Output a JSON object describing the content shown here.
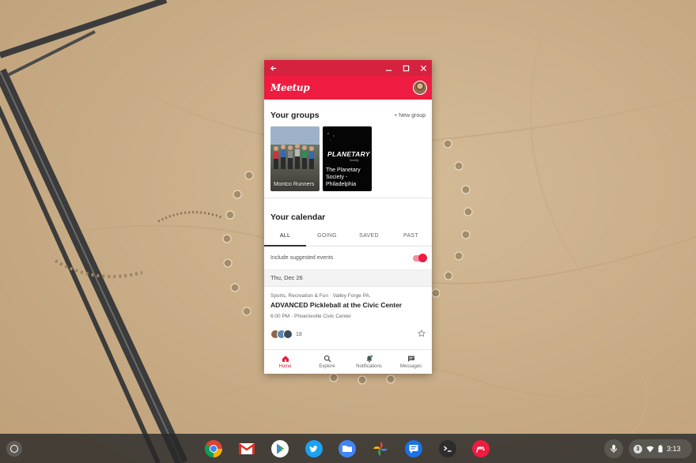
{
  "window": {
    "back_icon": "arrow-left-icon",
    "controls": [
      "minimize-icon",
      "maximize-icon",
      "close-icon"
    ]
  },
  "app": {
    "logo_text": "Meetup",
    "accent_color": "#ed1c40",
    "titlebar_color": "#d5223f"
  },
  "groups": {
    "heading": "Your groups",
    "new_group_label": "+ New group",
    "items": [
      {
        "name": "Montco Runners"
      },
      {
        "name": "The Planetary Society - Philadelphia",
        "logo_text": "PLANETARY",
        "logo_sub": "Society"
      }
    ]
  },
  "calendar": {
    "heading": "Your calendar",
    "tabs": [
      "ALL",
      "GOING",
      "SAVED",
      "PAST"
    ],
    "active_tab": "ALL",
    "suggested_label": "Include suggested events",
    "suggested_on": true,
    "day_label": "Thu, Dec 26",
    "event": {
      "category": "Sports, Recreation & Fun · Valley Forge PA.",
      "title": "ADVANCED Pickleball at the Civic Center",
      "time_location": "6:00 PM · Phoenixville Civic Center",
      "attendee_count": "18"
    }
  },
  "bottom_nav": [
    {
      "label": "Home",
      "icon": "home-icon",
      "active": true
    },
    {
      "label": "Explore",
      "icon": "search-icon",
      "active": false
    },
    {
      "label": "Notifications",
      "icon": "bell-icon",
      "active": false
    },
    {
      "label": "Messages",
      "icon": "message-icon",
      "active": false
    }
  ],
  "shelf": {
    "apps": [
      "chrome-icon",
      "gmail-icon",
      "play-store-icon",
      "twitter-icon",
      "files-icon",
      "photos-icon",
      "messages-app-icon",
      "terminal-icon",
      "meetup-app-icon"
    ],
    "notification_count": "3",
    "time": "3:13"
  }
}
